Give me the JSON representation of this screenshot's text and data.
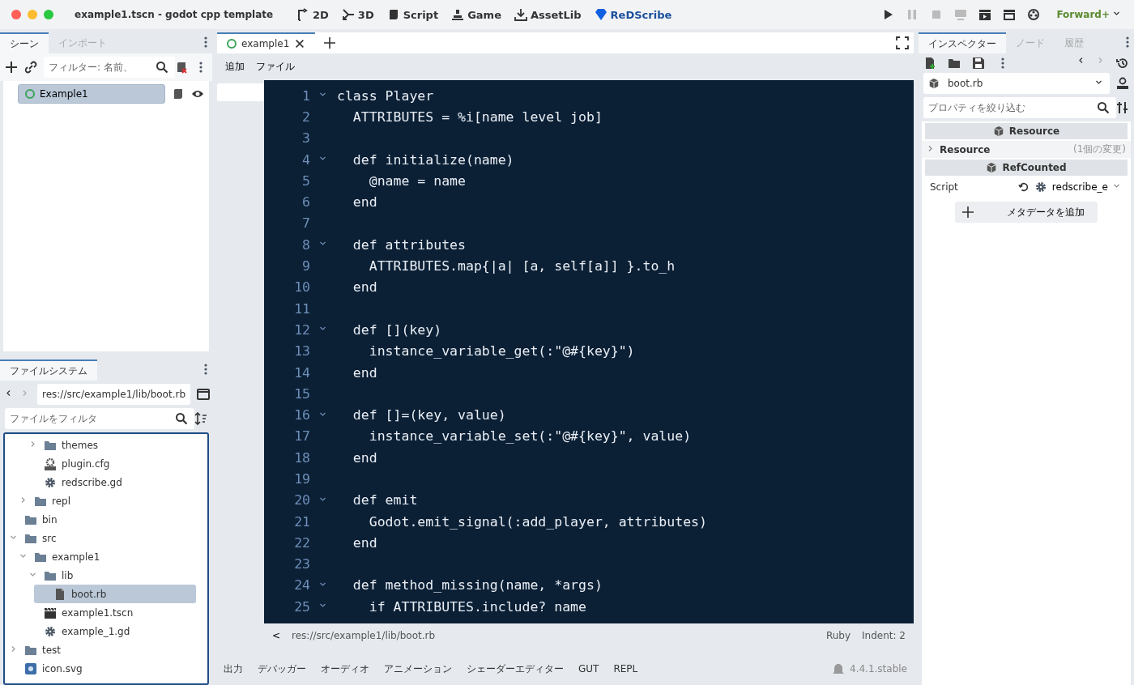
{
  "window": {
    "title": "example1.tscn - godot cpp template"
  },
  "main_screens": [
    {
      "label": "2D",
      "selected": false
    },
    {
      "label": "3D",
      "selected": false
    },
    {
      "label": "Script",
      "selected": false
    },
    {
      "label": "Game",
      "selected": false
    },
    {
      "label": "AssetLib",
      "selected": false
    },
    {
      "label": "ReDScribe",
      "selected": true
    }
  ],
  "run_buttons": [
    {
      "disabled": false
    },
    {
      "disabled": true
    },
    {
      "disabled": true
    },
    {
      "disabled": true
    },
    {
      "disabled": false
    },
    {
      "disabled": false
    },
    {
      "disabled": false
    }
  ],
  "renderer": "Forward+",
  "scene_dock": {
    "tabs": [
      {
        "label": "シーン",
        "selected": true
      },
      {
        "label": "インポート",
        "selected": false
      }
    ],
    "filter_placeholder": "フィルター: 名前、",
    "nodes": [
      {
        "label": "Example1",
        "selected": true
      }
    ]
  },
  "filesystem_dock": {
    "tabs": [
      {
        "label": "ファイルシステム",
        "selected": true
      }
    ],
    "path": "res://src/example1/lib/boot.rb",
    "filter_placeholder": "ファイルをフィルタ",
    "tree": [
      {
        "children": [
          {
            "children": [
              {
                "label": "themes",
                "kind": "folder",
                "expanded": false,
                "selected": false
              },
              {
                "label": "plugin.cfg",
                "kind": "config",
                "selected": false
              },
              {
                "label": "redscribe.gd",
                "kind": "script",
                "selected": false
              }
            ]
          },
          {
            "label": "repl",
            "kind": "folder",
            "expanded": false,
            "selected": false
          }
        ]
      },
      {
        "label": "bin",
        "kind": "folder",
        "selected": false
      },
      {
        "label": "src",
        "kind": "folder",
        "expanded": true,
        "selected": false,
        "children": [
          {
            "label": "example1",
            "kind": "folder",
            "expanded": true,
            "selected": false,
            "children": [
              {
                "label": "lib",
                "kind": "folder",
                "expanded": true,
                "selected": false,
                "children": [
                  {
                    "label": "boot.rb",
                    "kind": "file",
                    "selected": true
                  }
                ]
              },
              {
                "label": "example1.tscn",
                "kind": "scene",
                "selected": false
              },
              {
                "label": "example_1.gd",
                "kind": "script",
                "selected": false
              }
            ]
          }
        ]
      },
      {
        "label": "test",
        "kind": "folder",
        "expanded": false,
        "selected": false
      },
      {
        "label": "icon.svg",
        "kind": "image",
        "selected": false
      }
    ]
  },
  "editor": {
    "tabs": [
      {
        "label": "example1",
        "selected": true
      }
    ],
    "menu": [
      "追加",
      "ファイル"
    ],
    "lines": [
      {
        "number": "1",
        "text": "class Player",
        "foldable": true
      },
      {
        "number": "2",
        "text": "  ATTRIBUTES = %i[name level job]",
        "foldable": false
      },
      {
        "number": "3",
        "foldable": false
      },
      {
        "number": "4",
        "text": "  def initialize(name)",
        "foldable": true
      },
      {
        "number": "5",
        "text": "    @name = name",
        "foldable": false
      },
      {
        "number": "6",
        "text": "  end",
        "foldable": false
      },
      {
        "number": "7",
        "foldable": false
      },
      {
        "number": "8",
        "text": "  def attributes",
        "foldable": true
      },
      {
        "number": "9",
        "text": "    ATTRIBUTES.map{|a| [a, self[a]] }.to_h",
        "foldable": false
      },
      {
        "number": "10",
        "text": "  end",
        "foldable": false
      },
      {
        "number": "11",
        "foldable": false
      },
      {
        "number": "12",
        "text": "  def [](key)",
        "foldable": true
      },
      {
        "number": "13",
        "text": "    instance_variable_get(:\"@#{key}\")",
        "foldable": false
      },
      {
        "number": "14",
        "text": "  end",
        "foldable": false
      },
      {
        "number": "15",
        "foldable": false
      },
      {
        "number": "16",
        "text": "  def []=(key, value)",
        "foldable": true
      },
      {
        "number": "17",
        "text": "    instance_variable_set(:\"@#{key}\", value)",
        "foldable": false
      },
      {
        "number": "18",
        "text": "  end",
        "foldable": false
      },
      {
        "number": "19",
        "foldable": false
      },
      {
        "number": "20",
        "text": "  def emit",
        "foldable": true
      },
      {
        "number": "21",
        "text": "    Godot.emit_signal(:add_player, attributes)",
        "foldable": false
      },
      {
        "number": "22",
        "text": "  end",
        "foldable": false
      },
      {
        "number": "23",
        "foldable": false
      },
      {
        "number": "24",
        "text": "  def method_missing(name, *args)",
        "foldable": true
      },
      {
        "number": "25",
        "text": "    if ATTRIBUTES.include? name",
        "foldable": true
      }
    ],
    "status": {
      "back": "<",
      "path": "res://src/example1/lib/boot.rb",
      "language": "Ruby",
      "indent": "Indent: 2"
    }
  },
  "bottom_panel": {
    "tabs": [
      "出力",
      "デバッガー",
      "オーディオ",
      "アニメーション",
      "シェーダーエディター",
      "GUT",
      "REPL"
    ],
    "version": "4.4.1.stable"
  },
  "inspector": {
    "tabs": [
      {
        "label": "インスペクター",
        "selected": true
      },
      {
        "label": "ノード",
        "selected": false
      },
      {
        "label": "履歴",
        "selected": false
      }
    ],
    "object": "boot.rb",
    "filter_placeholder": "プロパティを絞り込む",
    "sections": [
      {
        "kind": "header",
        "label": "Resource"
      },
      {
        "kind": "group",
        "label": "Resource",
        "note": "(1個の変更)",
        "expanded": false
      },
      {
        "kind": "header",
        "label": "RefCounted"
      },
      {
        "kind": "property",
        "label": "Script",
        "value": "redscribe_e"
      }
    ],
    "add_metadata": "メタデータを追加"
  }
}
